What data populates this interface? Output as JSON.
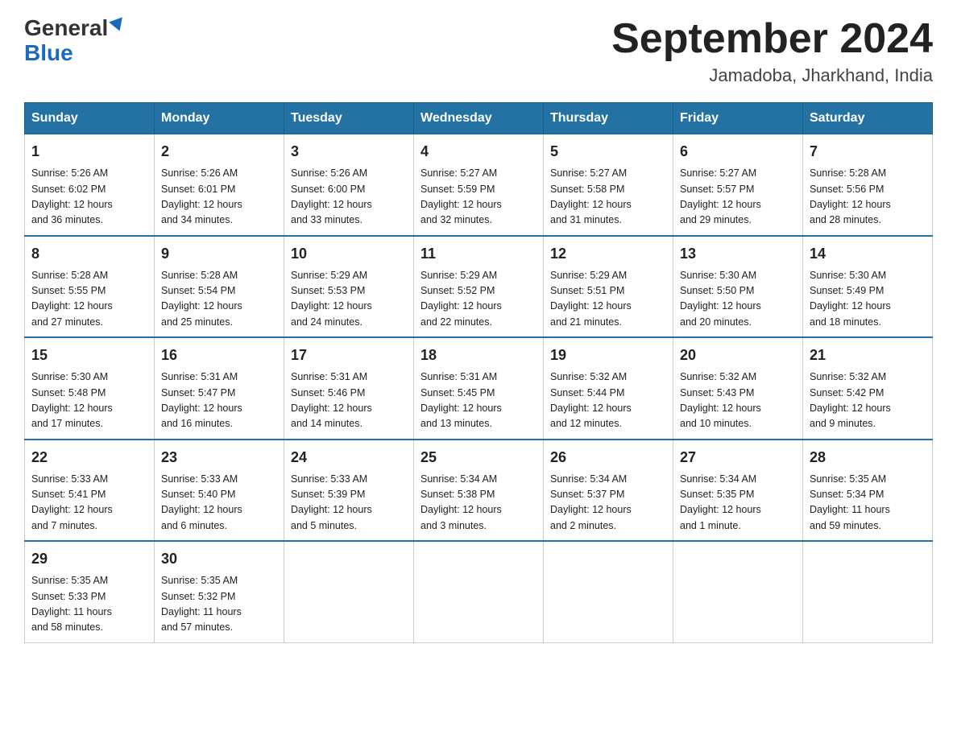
{
  "header": {
    "logo_line1": "General",
    "logo_line2": "Blue",
    "title": "September 2024",
    "subtitle": "Jamadoba, Jharkhand, India"
  },
  "weekdays": [
    "Sunday",
    "Monday",
    "Tuesday",
    "Wednesday",
    "Thursday",
    "Friday",
    "Saturday"
  ],
  "weeks": [
    [
      {
        "day": "1",
        "sunrise": "5:26 AM",
        "sunset": "6:02 PM",
        "daylight": "12 hours and 36 minutes."
      },
      {
        "day": "2",
        "sunrise": "5:26 AM",
        "sunset": "6:01 PM",
        "daylight": "12 hours and 34 minutes."
      },
      {
        "day": "3",
        "sunrise": "5:26 AM",
        "sunset": "6:00 PM",
        "daylight": "12 hours and 33 minutes."
      },
      {
        "day": "4",
        "sunrise": "5:27 AM",
        "sunset": "5:59 PM",
        "daylight": "12 hours and 32 minutes."
      },
      {
        "day": "5",
        "sunrise": "5:27 AM",
        "sunset": "5:58 PM",
        "daylight": "12 hours and 31 minutes."
      },
      {
        "day": "6",
        "sunrise": "5:27 AM",
        "sunset": "5:57 PM",
        "daylight": "12 hours and 29 minutes."
      },
      {
        "day": "7",
        "sunrise": "5:28 AM",
        "sunset": "5:56 PM",
        "daylight": "12 hours and 28 minutes."
      }
    ],
    [
      {
        "day": "8",
        "sunrise": "5:28 AM",
        "sunset": "5:55 PM",
        "daylight": "12 hours and 27 minutes."
      },
      {
        "day": "9",
        "sunrise": "5:28 AM",
        "sunset": "5:54 PM",
        "daylight": "12 hours and 25 minutes."
      },
      {
        "day": "10",
        "sunrise": "5:29 AM",
        "sunset": "5:53 PM",
        "daylight": "12 hours and 24 minutes."
      },
      {
        "day": "11",
        "sunrise": "5:29 AM",
        "sunset": "5:52 PM",
        "daylight": "12 hours and 22 minutes."
      },
      {
        "day": "12",
        "sunrise": "5:29 AM",
        "sunset": "5:51 PM",
        "daylight": "12 hours and 21 minutes."
      },
      {
        "day": "13",
        "sunrise": "5:30 AM",
        "sunset": "5:50 PM",
        "daylight": "12 hours and 20 minutes."
      },
      {
        "day": "14",
        "sunrise": "5:30 AM",
        "sunset": "5:49 PM",
        "daylight": "12 hours and 18 minutes."
      }
    ],
    [
      {
        "day": "15",
        "sunrise": "5:30 AM",
        "sunset": "5:48 PM",
        "daylight": "12 hours and 17 minutes."
      },
      {
        "day": "16",
        "sunrise": "5:31 AM",
        "sunset": "5:47 PM",
        "daylight": "12 hours and 16 minutes."
      },
      {
        "day": "17",
        "sunrise": "5:31 AM",
        "sunset": "5:46 PM",
        "daylight": "12 hours and 14 minutes."
      },
      {
        "day": "18",
        "sunrise": "5:31 AM",
        "sunset": "5:45 PM",
        "daylight": "12 hours and 13 minutes."
      },
      {
        "day": "19",
        "sunrise": "5:32 AM",
        "sunset": "5:44 PM",
        "daylight": "12 hours and 12 minutes."
      },
      {
        "day": "20",
        "sunrise": "5:32 AM",
        "sunset": "5:43 PM",
        "daylight": "12 hours and 10 minutes."
      },
      {
        "day": "21",
        "sunrise": "5:32 AM",
        "sunset": "5:42 PM",
        "daylight": "12 hours and 9 minutes."
      }
    ],
    [
      {
        "day": "22",
        "sunrise": "5:33 AM",
        "sunset": "5:41 PM",
        "daylight": "12 hours and 7 minutes."
      },
      {
        "day": "23",
        "sunrise": "5:33 AM",
        "sunset": "5:40 PM",
        "daylight": "12 hours and 6 minutes."
      },
      {
        "day": "24",
        "sunrise": "5:33 AM",
        "sunset": "5:39 PM",
        "daylight": "12 hours and 5 minutes."
      },
      {
        "day": "25",
        "sunrise": "5:34 AM",
        "sunset": "5:38 PM",
        "daylight": "12 hours and 3 minutes."
      },
      {
        "day": "26",
        "sunrise": "5:34 AM",
        "sunset": "5:37 PM",
        "daylight": "12 hours and 2 minutes."
      },
      {
        "day": "27",
        "sunrise": "5:34 AM",
        "sunset": "5:35 PM",
        "daylight": "12 hours and 1 minute."
      },
      {
        "day": "28",
        "sunrise": "5:35 AM",
        "sunset": "5:34 PM",
        "daylight": "11 hours and 59 minutes."
      }
    ],
    [
      {
        "day": "29",
        "sunrise": "5:35 AM",
        "sunset": "5:33 PM",
        "daylight": "11 hours and 58 minutes."
      },
      {
        "day": "30",
        "sunrise": "5:35 AM",
        "sunset": "5:32 PM",
        "daylight": "11 hours and 57 minutes."
      },
      null,
      null,
      null,
      null,
      null
    ]
  ],
  "labels": {
    "sunrise": "Sunrise:",
    "sunset": "Sunset:",
    "daylight": "Daylight:"
  }
}
